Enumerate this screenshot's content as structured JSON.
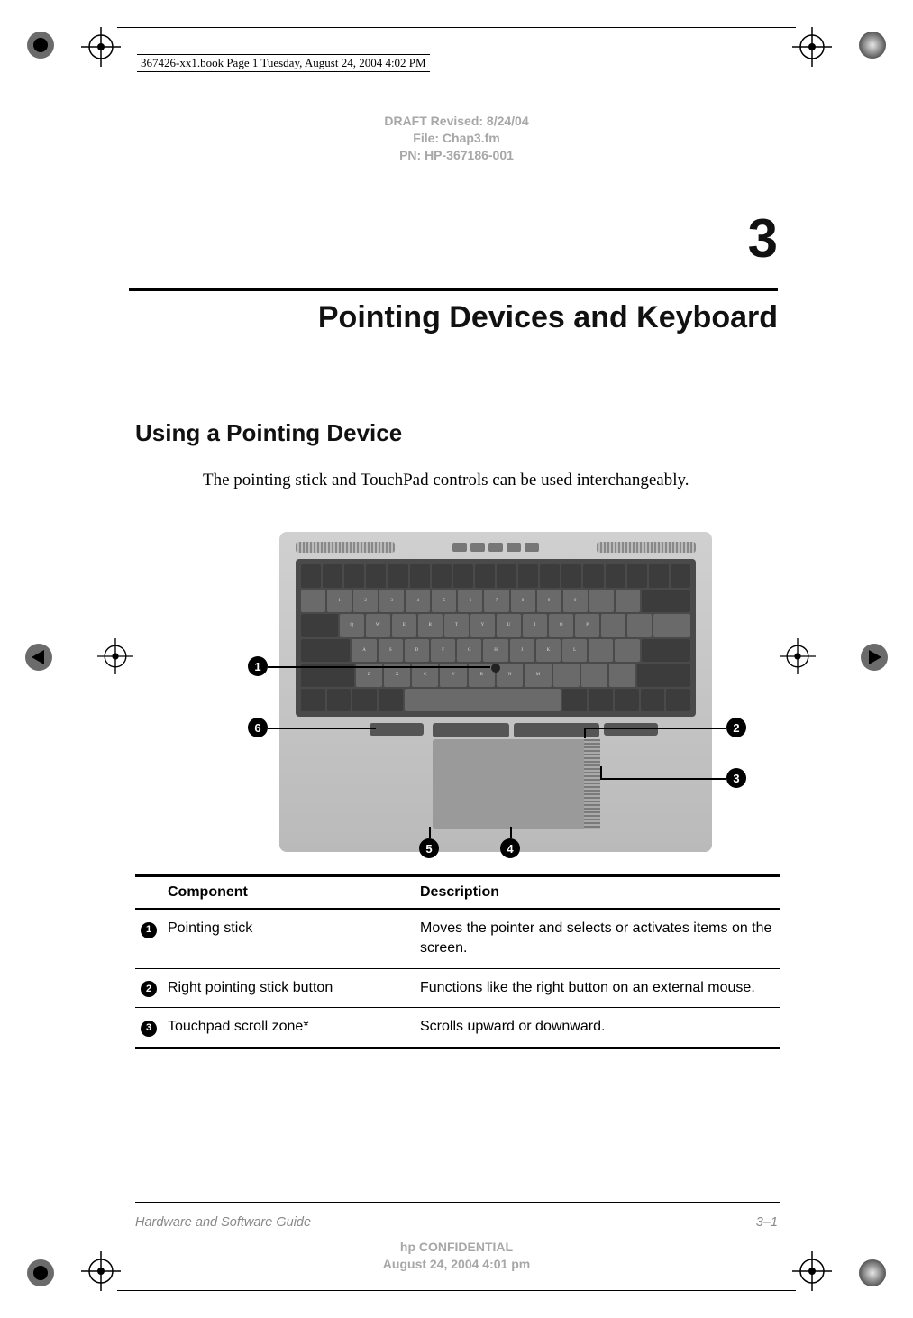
{
  "book_info": "367426-xx1.book  Page 1  Tuesday, August 24, 2004  4:02 PM",
  "draft": {
    "line1": "DRAFT Revised: 8/24/04",
    "line2": "File: Chap3.fm",
    "line3": "PN: HP-367186-001"
  },
  "chapter_number": "3",
  "chapter_title": "Pointing Devices and Keyboard",
  "section_heading": "Using a Pointing Device",
  "body_text": "The pointing stick and TouchPad controls can be used interchangeably.",
  "callouts": {
    "c1": "1",
    "c2": "2",
    "c3": "3",
    "c4": "4",
    "c5": "5",
    "c6": "6"
  },
  "table": {
    "head_component": "Component",
    "head_description": "Description",
    "rows": [
      {
        "num": "1",
        "component": "Pointing stick",
        "description": "Moves the pointer and selects or activates items on the screen."
      },
      {
        "num": "2",
        "component": "Right pointing stick button",
        "description": "Functions like the right button on an external mouse."
      },
      {
        "num": "3",
        "component": "Touchpad scroll zone*",
        "description": "Scrolls upward or downward."
      }
    ]
  },
  "footer": {
    "left": "Hardware and Software Guide",
    "right": "3–1",
    "center1": "hp CONFIDENTIAL",
    "center2": "August 24, 2004 4:01 pm"
  }
}
